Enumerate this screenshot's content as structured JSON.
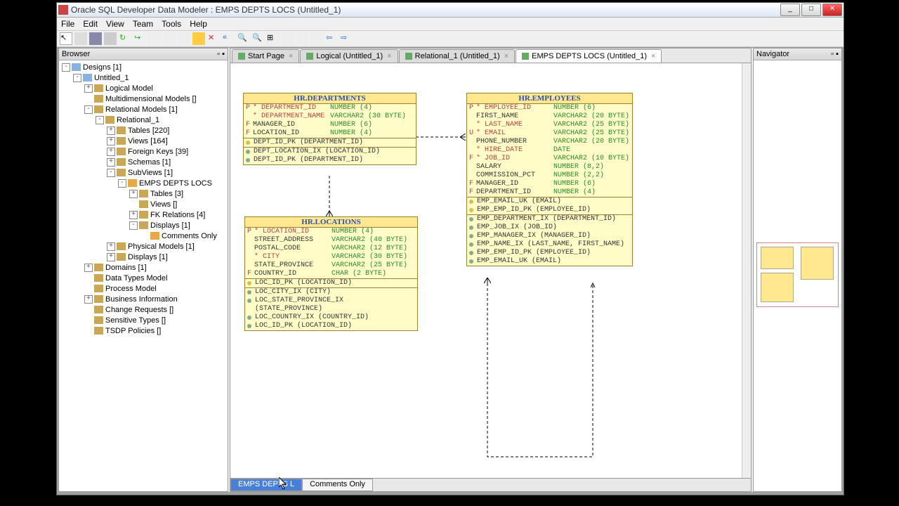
{
  "window": {
    "title": "Oracle SQL Developer Data Modeler : EMPS DEPTS LOCS (Untitled_1)"
  },
  "menubar": [
    "File",
    "Edit",
    "View",
    "Team",
    "Tools",
    "Help"
  ],
  "panels": {
    "browser": "Browser",
    "navigator": "Navigator"
  },
  "tree": [
    {
      "depth": 0,
      "exp": "-",
      "icon": "ic-model",
      "label": "Designs [1]"
    },
    {
      "depth": 1,
      "exp": "-",
      "icon": "ic-model",
      "label": "Untitled_1"
    },
    {
      "depth": 2,
      "exp": "+",
      "icon": "ic-folder",
      "label": "Logical Model"
    },
    {
      "depth": 2,
      "exp": "",
      "icon": "ic-folder",
      "label": "Multidimensional Models []"
    },
    {
      "depth": 2,
      "exp": "-",
      "icon": "ic-folder",
      "label": "Relational Models [1]"
    },
    {
      "depth": 3,
      "exp": "-",
      "icon": "ic-folder",
      "label": "Relational_1"
    },
    {
      "depth": 4,
      "exp": "+",
      "icon": "ic-folder",
      "label": "Tables [220]"
    },
    {
      "depth": 4,
      "exp": "+",
      "icon": "ic-folder",
      "label": "Views [164]"
    },
    {
      "depth": 4,
      "exp": "+",
      "icon": "ic-folder",
      "label": "Foreign Keys [39]"
    },
    {
      "depth": 4,
      "exp": "+",
      "icon": "ic-folder",
      "label": "Schemas [1]"
    },
    {
      "depth": 4,
      "exp": "-",
      "icon": "ic-folder",
      "label": "SubViews [1]"
    },
    {
      "depth": 5,
      "exp": "-",
      "icon": "ic-disp",
      "label": "EMPS DEPTS LOCS"
    },
    {
      "depth": 6,
      "exp": "+",
      "icon": "ic-folder",
      "label": "Tables [3]"
    },
    {
      "depth": 6,
      "exp": "",
      "icon": "ic-folder",
      "label": "Views []"
    },
    {
      "depth": 6,
      "exp": "+",
      "icon": "ic-folder",
      "label": "FK Relations [4]"
    },
    {
      "depth": 6,
      "exp": "-",
      "icon": "ic-folder",
      "label": "Displays [1]"
    },
    {
      "depth": 7,
      "exp": "",
      "icon": "ic-disp",
      "label": "Comments Only"
    },
    {
      "depth": 4,
      "exp": "+",
      "icon": "ic-folder",
      "label": "Physical Models [1]"
    },
    {
      "depth": 4,
      "exp": "+",
      "icon": "ic-folder",
      "label": "Displays [1]"
    },
    {
      "depth": 2,
      "exp": "+",
      "icon": "ic-folder",
      "label": "Domains [1]"
    },
    {
      "depth": 2,
      "exp": "",
      "icon": "ic-folder",
      "label": "Data Types Model"
    },
    {
      "depth": 2,
      "exp": "",
      "icon": "ic-folder",
      "label": "Process Model"
    },
    {
      "depth": 2,
      "exp": "+",
      "icon": "ic-folder",
      "label": "Business Information"
    },
    {
      "depth": 2,
      "exp": "",
      "icon": "ic-folder",
      "label": "Change Requests []"
    },
    {
      "depth": 2,
      "exp": "",
      "icon": "ic-folder",
      "label": "Sensitive Types []"
    },
    {
      "depth": 2,
      "exp": "",
      "icon": "ic-folder",
      "label": "TSDP Policies []"
    }
  ],
  "tabs": [
    {
      "label": "Start Page",
      "active": false
    },
    {
      "label": "Logical (Untitled_1)",
      "active": false
    },
    {
      "label": "Relational_1 (Untitled_1)",
      "active": false
    },
    {
      "label": "EMPS DEPTS LOCS (Untitled_1)",
      "active": true
    }
  ],
  "footer_tabs": [
    {
      "label": "EMPS DEPTS L",
      "active": true
    },
    {
      "label": "Comments Only",
      "active": false
    }
  ],
  "entities": {
    "departments": {
      "title": "HR.DEPARTMENTS",
      "cols": [
        {
          "flag": "P",
          "req": true,
          "name": "DEPARTMENT_ID",
          "type": "NUMBER (4)"
        },
        {
          "flag": "",
          "req": true,
          "name": "DEPARTMENT_NAME",
          "type": "VARCHAR2 (30 BYTE)"
        },
        {
          "flag": "F",
          "req": false,
          "name": "MANAGER_ID",
          "type": "NUMBER (6)"
        },
        {
          "flag": "F",
          "req": false,
          "name": "LOCATION_ID",
          "type": "NUMBER (4)"
        }
      ],
      "pk": "DEPT_ID_PK (DEPARTMENT_ID)",
      "idx": [
        "DEPT_LOCATION_IX (LOCATION_ID)",
        "DEPT_ID_PK (DEPARTMENT_ID)"
      ]
    },
    "employees": {
      "title": "HR.EMPLOYEES",
      "cols": [
        {
          "flag": "P",
          "req": true,
          "name": "EMPLOYEE_ID",
          "type": "NUMBER (6)"
        },
        {
          "flag": "",
          "req": false,
          "name": "FIRST_NAME",
          "type": "VARCHAR2 (20 BYTE)"
        },
        {
          "flag": "",
          "req": true,
          "name": "LAST_NAME",
          "type": "VARCHAR2 (25 BYTE)"
        },
        {
          "flag": "U",
          "req": true,
          "name": "EMAIL",
          "type": "VARCHAR2 (25 BYTE)"
        },
        {
          "flag": "",
          "req": false,
          "name": "PHONE_NUMBER",
          "type": "VARCHAR2 (20 BYTE)"
        },
        {
          "flag": "",
          "req": true,
          "name": "HIRE_DATE",
          "type": "DATE"
        },
        {
          "flag": "F",
          "req": true,
          "name": "JOB_ID",
          "type": "VARCHAR2 (10 BYTE)"
        },
        {
          "flag": "",
          "req": false,
          "name": "SALARY",
          "type": "NUMBER (8,2)"
        },
        {
          "flag": "",
          "req": false,
          "name": "COMMISSION_PCT",
          "type": "NUMBER (2,2)"
        },
        {
          "flag": "F",
          "req": false,
          "name": "MANAGER_ID",
          "type": "NUMBER (6)"
        },
        {
          "flag": "F",
          "req": false,
          "name": "DEPARTMENT_ID",
          "type": "NUMBER (4)"
        }
      ],
      "uk": [
        "EMP_EMAIL_UK (EMAIL)",
        "EMP_EMP_ID_PK (EMPLOYEE_ID)"
      ],
      "idx": [
        "EMP_DEPARTMENT_IX (DEPARTMENT_ID)",
        "EMP_JOB_IX (JOB_ID)",
        "EMP_MANAGER_IX (MANAGER_ID)",
        "EMP_NAME_IX (LAST_NAME, FIRST_NAME)",
        "EMP_EMP_ID_PK (EMPLOYEE_ID)",
        "EMP_EMAIL_UK (EMAIL)"
      ]
    },
    "locations": {
      "title": "HR.LOCATIONS",
      "cols": [
        {
          "flag": "P",
          "req": true,
          "name": "LOCATION_ID",
          "type": "NUMBER (4)"
        },
        {
          "flag": "",
          "req": false,
          "name": "STREET_ADDRESS",
          "type": "VARCHAR2 (40 BYTE)"
        },
        {
          "flag": "",
          "req": false,
          "name": "POSTAL_CODE",
          "type": "VARCHAR2 (12 BYTE)"
        },
        {
          "flag": "",
          "req": true,
          "name": "CITY",
          "type": "VARCHAR2 (30 BYTE)"
        },
        {
          "flag": "",
          "req": false,
          "name": "STATE_PROVINCE",
          "type": "VARCHAR2 (25 BYTE)"
        },
        {
          "flag": "F",
          "req": false,
          "name": "COUNTRY_ID",
          "type": "CHAR (2 BYTE)"
        }
      ],
      "pk": "LOC_ID_PK (LOCATION_ID)",
      "idx": [
        "LOC_CITY_IX (CITY)",
        "LOC_STATE_PROVINCE_IX (STATE_PROVINCE)",
        "LOC_COUNTRY_IX (COUNTRY_ID)",
        "LOC_ID_PK (LOCATION_ID)"
      ]
    }
  }
}
